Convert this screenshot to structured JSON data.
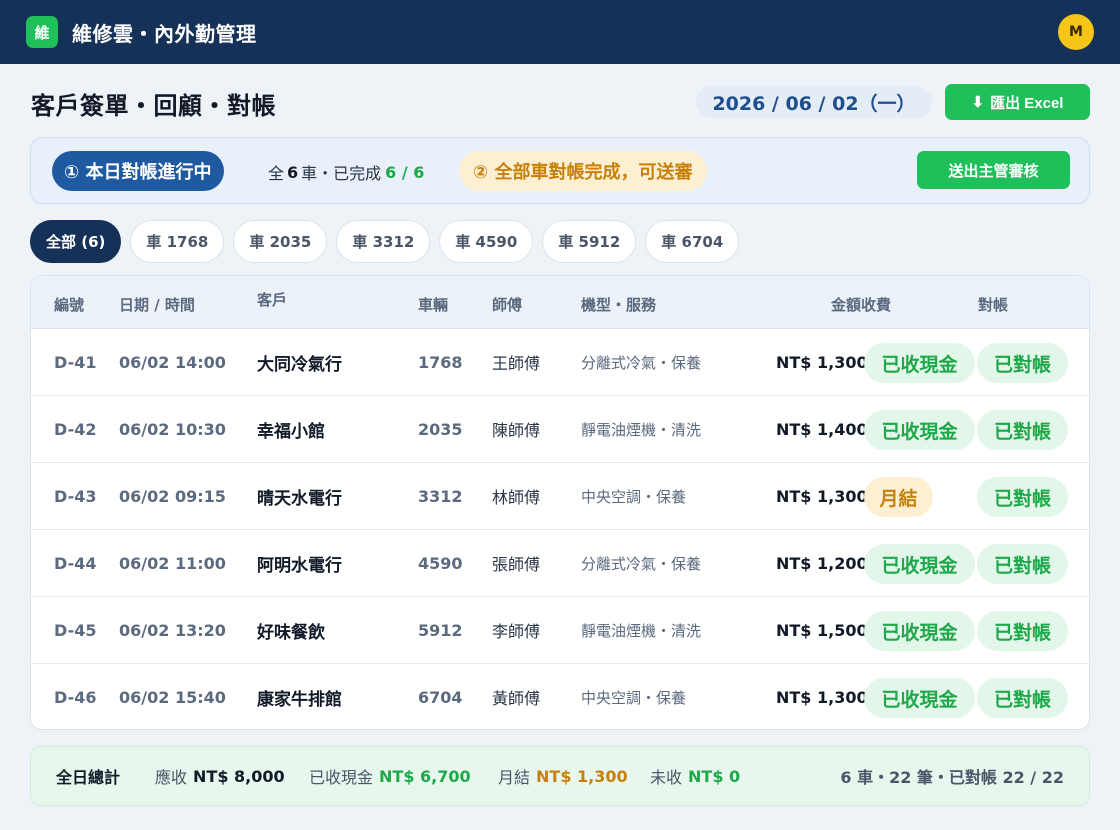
{
  "app": {
    "logo": "維",
    "title": "維修雲・內外勤管理",
    "avatar": "M"
  },
  "header": {
    "page_title": "客戶簽單・回顧・對帳",
    "date": "2026 / 06 / 02（一）",
    "export_label": "匯出 Excel",
    "export_icon": "⬇"
  },
  "status": {
    "step1": "① 本日對帳進行中",
    "summary_prefix": "全",
    "summary_cars": "6",
    "summary_mid": "車・已完成",
    "summary_done": "6 / 6",
    "step2": "② 全部車對帳完成，可送審",
    "submit_label": "送出主管審核"
  },
  "filters": [
    "全部 (6)",
    "車 1768",
    "車 2035",
    "車 3312",
    "車 4590",
    "車 5912",
    "車 6704"
  ],
  "table": {
    "headers": {
      "id": "編號",
      "datetime": "日期 / 時間",
      "customer": "客戶",
      "car": "車輛",
      "technician": "師傅",
      "service": "機型・服務",
      "amount": "金額收費",
      "reconcile": "對帳"
    },
    "rows": [
      {
        "id": "D-41",
        "datetime": "06/02 14:00",
        "customer": "大同冷氣行",
        "car": "1768",
        "technician": "王師傅",
        "service": "分離式冷氣・保養",
        "amount": "NT$ 1,300",
        "payment": "已收現金",
        "payment_type": "cash",
        "reconcile": "已對帳"
      },
      {
        "id": "D-42",
        "datetime": "06/02 10:30",
        "customer": "幸福小館",
        "car": "2035",
        "technician": "陳師傅",
        "service": "靜電油煙機・清洗",
        "amount": "NT$ 1,400",
        "payment": "已收現金",
        "payment_type": "cash",
        "reconcile": "已對帳"
      },
      {
        "id": "D-43",
        "datetime": "06/02 09:15",
        "customer": "晴天水電行",
        "car": "3312",
        "technician": "林師傅",
        "service": "中央空調・保養",
        "amount": "NT$ 1,300",
        "payment": "月結",
        "payment_type": "monthly",
        "reconcile": "已對帳"
      },
      {
        "id": "D-44",
        "datetime": "06/02 11:00",
        "customer": "阿明水電行",
        "car": "4590",
        "technician": "張師傅",
        "service": "分離式冷氣・保養",
        "amount": "NT$ 1,200",
        "payment": "已收現金",
        "payment_type": "cash",
        "reconcile": "已對帳"
      },
      {
        "id": "D-45",
        "datetime": "06/02 13:20",
        "customer": "好味餐飲",
        "car": "5912",
        "technician": "李師傅",
        "service": "靜電油煙機・清洗",
        "amount": "NT$ 1,500",
        "payment": "已收現金",
        "payment_type": "cash",
        "reconcile": "已對帳"
      },
      {
        "id": "D-46",
        "datetime": "06/02 15:40",
        "customer": "康家牛排館",
        "car": "6704",
        "technician": "黃師傅",
        "service": "中央空調・保養",
        "amount": "NT$ 1,300",
        "payment": "已收現金",
        "payment_type": "cash",
        "reconcile": "已對帳"
      }
    ]
  },
  "totals": {
    "title": "全日總計",
    "due_label": "應收",
    "due_value": "NT$ 8,000",
    "cash_label": "已收現金",
    "cash_value": "NT$ 6,700",
    "monthly_label": "月結",
    "monthly_value": "NT$ 1,300",
    "unpaid_label": "未收",
    "unpaid_value": "NT$ 0",
    "summary": "6 車・22 筆・已對帳 22 / 22"
  },
  "colors": {
    "navy": "#163158",
    "green": "#1fbf5a",
    "green_text": "#1fa84a",
    "amber_text": "#c7800b",
    "blue_pill": "#1f5aa0"
  }
}
